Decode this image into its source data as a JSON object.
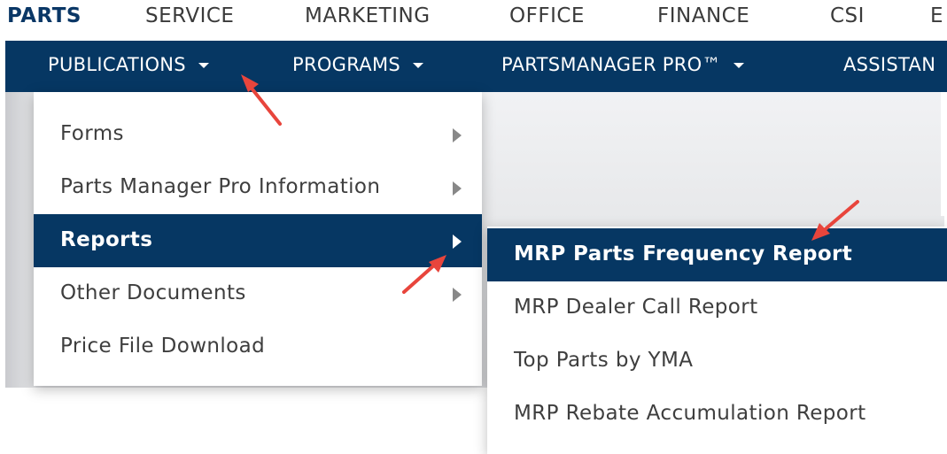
{
  "top_nav": {
    "items": [
      "PARTS",
      "SERVICE",
      "MARKETING",
      "OFFICE",
      "FINANCE",
      "CSI",
      "E"
    ],
    "active": "PARTS"
  },
  "sub_nav": {
    "items": [
      "PUBLICATIONS",
      "PROGRAMS",
      "PARTSMANAGER PRO™",
      "ASSISTAN"
    ]
  },
  "menu": {
    "items": [
      {
        "label": "Forms",
        "has_submenu": true,
        "active": false
      },
      {
        "label": "Parts Manager Pro Information",
        "has_submenu": true,
        "active": false
      },
      {
        "label": "Reports",
        "has_submenu": true,
        "active": true
      },
      {
        "label": "Other Documents",
        "has_submenu": true,
        "active": false
      },
      {
        "label": "Price File Download",
        "has_submenu": false,
        "active": false
      }
    ]
  },
  "submenu": {
    "items": [
      {
        "label": "MRP Parts Frequency Report",
        "active": true
      },
      {
        "label": "MRP Dealer Call Report",
        "active": false
      },
      {
        "label": "Top Parts by YMA",
        "active": false
      },
      {
        "label": "MRP Rebate Accumulation Report",
        "active": false
      }
    ]
  },
  "colors": {
    "nav_bar": "#063763",
    "active_row": "#063763",
    "active_top": "#0a3766",
    "annotation_arrow": "#e8453c"
  },
  "icons": [
    "caret-down-icon",
    "triangle-right-icon",
    "annotation-arrow"
  ]
}
